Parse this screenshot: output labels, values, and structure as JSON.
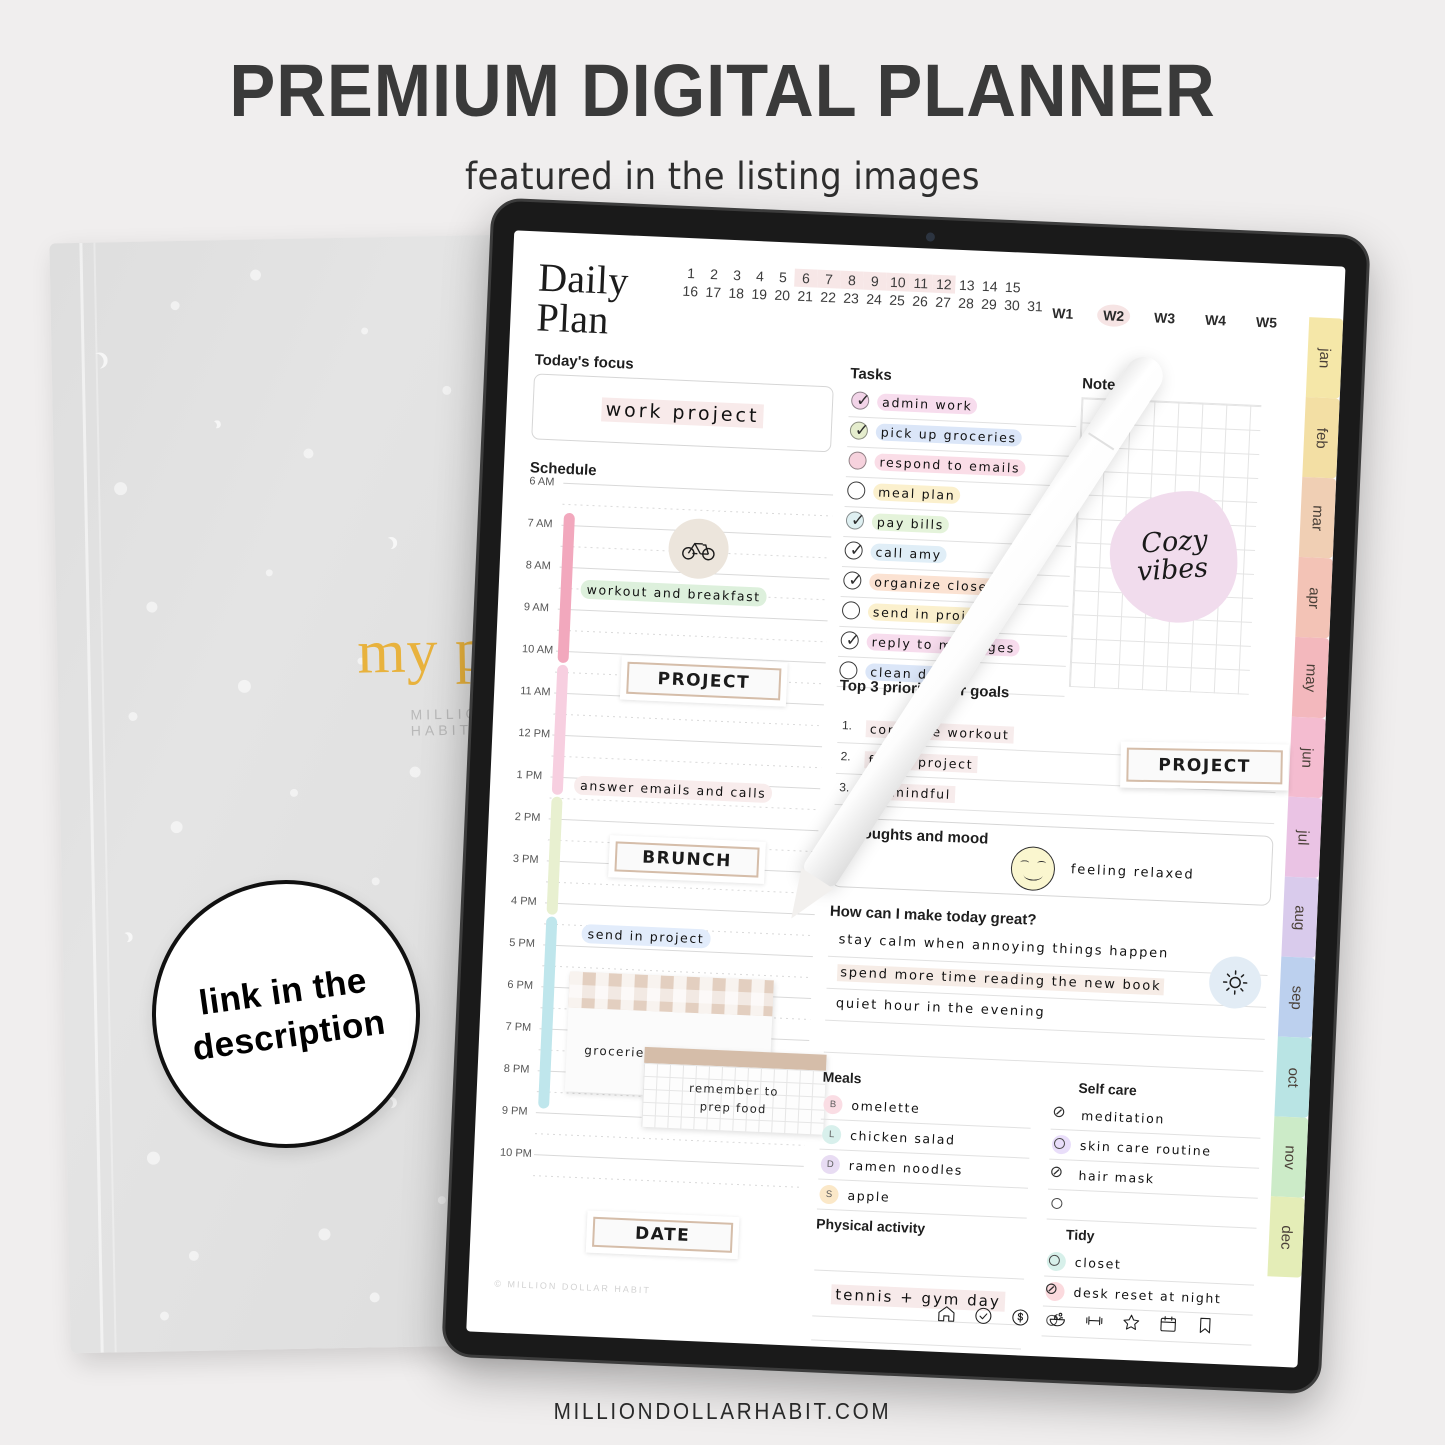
{
  "promo": {
    "title": "PREMIUM DIGITAL PLANNER",
    "subtitle": "featured in the listing images",
    "website": "MILLIONDOLLARHABIT.COM"
  },
  "badge": {
    "line1": "link in the",
    "line2": "description"
  },
  "notebook": {
    "title": "my plan",
    "brand": "MILLION DOLLAR HABIT"
  },
  "planner": {
    "page_title": "Daily Plan",
    "dates_row1": [
      "1",
      "2",
      "3",
      "4",
      "5",
      "6",
      "7",
      "8",
      "9",
      "10",
      "11",
      "12",
      "13",
      "14",
      "15"
    ],
    "dates_row2": [
      "16",
      "17",
      "18",
      "19",
      "20",
      "21",
      "22",
      "23",
      "24",
      "25",
      "26",
      "27",
      "28",
      "29",
      "30",
      "31"
    ],
    "highlighted_dates": [
      "6",
      "7",
      "8",
      "9",
      "10",
      "11",
      "12"
    ],
    "weeks": [
      "W1",
      "W2",
      "W3",
      "W4",
      "W5"
    ],
    "selected_week": "W2",
    "months": [
      {
        "label": "jan",
        "color": "#f5e7a8"
      },
      {
        "label": "feb",
        "color": "#f3dfa4"
      },
      {
        "label": "mar",
        "color": "#f0cfb4"
      },
      {
        "label": "apr",
        "color": "#f3c3b6"
      },
      {
        "label": "may",
        "color": "#f3b8bd"
      },
      {
        "label": "jun",
        "color": "#f4bcd0"
      },
      {
        "label": "jul",
        "color": "#eac3e4"
      },
      {
        "label": "aug",
        "color": "#d9cbec"
      },
      {
        "label": "sep",
        "color": "#bcd0ee"
      },
      {
        "label": "oct",
        "color": "#b9e4e4"
      },
      {
        "label": "nov",
        "color": "#ccebc8"
      },
      {
        "label": "dec",
        "color": "#e4edb7"
      }
    ],
    "focus": {
      "label": "Today's focus",
      "value": "work project"
    },
    "schedule": {
      "label": "Schedule",
      "times": [
        "6 AM",
        "7 AM",
        "8 AM",
        "9 AM",
        "10 AM",
        "11 AM",
        "12 PM",
        "1 PM",
        "2 PM",
        "3 PM",
        "4 PM",
        "5 PM",
        "6 PM",
        "7 PM",
        "8 PM",
        "9 PM",
        "10 PM"
      ],
      "icon": "bicycle-icon",
      "entries": [
        {
          "text": "workout and breakfast",
          "color": "#ddf0dc"
        },
        {
          "text": "PROJECT",
          "type": "box"
        },
        {
          "text": "answer emails and calls",
          "color": "#f8ecec"
        },
        {
          "text": "BRUNCH",
          "type": "box"
        },
        {
          "text": "send in project",
          "color": "#e2ecfb"
        },
        {
          "text": "DATE",
          "type": "box"
        }
      ],
      "timebars": [
        {
          "color": "#f2a8bd"
        },
        {
          "color": "#f7cfe0"
        },
        {
          "color": "#e8f0d0"
        },
        {
          "color": "#bfe6ec"
        }
      ],
      "sticky_note_1": "groceries and planning",
      "sticky_note_2_line1": "remember to",
      "sticky_note_2_line2": "prep food"
    },
    "tasks": {
      "label": "Tasks",
      "items": [
        {
          "text": "admin work",
          "color": "#f7dced",
          "check": "checked",
          "bullet": "#f2d4e8"
        },
        {
          "text": "pick up groceries",
          "color": "#dbe6f8",
          "check": "checked",
          "bullet": "#e5edcd"
        },
        {
          "text": "respond to emails",
          "color": "#fadde7",
          "check": "empty",
          "bullet": "#f6d2dd"
        },
        {
          "text": "meal plan",
          "color": "#fbf0cd",
          "check": "empty",
          "bullet": "#ffffff"
        },
        {
          "text": "pay bills",
          "color": "#e4f3da",
          "check": "checked",
          "bullet": "#dff0f2"
        },
        {
          "text": "call amy",
          "color": "#e0eef7",
          "check": "checked",
          "bullet": "#ffffff"
        },
        {
          "text": "organize closet",
          "color": "#fbe2d2",
          "check": "checked",
          "bullet": "#ffffff"
        },
        {
          "text": "send in project",
          "color": "#fbf0cd",
          "check": "empty",
          "bullet": "#ffffff"
        },
        {
          "text": "reply to messages",
          "color": "#f7dced",
          "check": "checked",
          "bullet": "#ffffff"
        },
        {
          "text": "clean desk",
          "color": "#dbe6f8",
          "check": "empty",
          "bullet": "#ffffff"
        }
      ]
    },
    "notes": {
      "label": "Notes",
      "sticker_line1": "Cozy",
      "sticker_line2": "vibes",
      "sticker_color": "#f1dced"
    },
    "priorities": {
      "label": "Top 3 priorities or goals",
      "items": [
        {
          "num": "1.",
          "text": "complete workout"
        },
        {
          "num": "2.",
          "text": "finish project"
        },
        {
          "num": "3.",
          "text": "be mindful"
        }
      ],
      "stamp": "PROJECT"
    },
    "mood": {
      "label": "Thoughts and mood",
      "icon": "smiley-face-icon",
      "text": "feeling relaxed"
    },
    "great": {
      "label": "How can I make today great?",
      "items": [
        {
          "text": "stay calm when annoying things happen",
          "highlight": false
        },
        {
          "text": "spend more time reading the new book",
          "highlight": true
        },
        {
          "text": "quiet hour in the evening",
          "highlight": false
        }
      ],
      "icon": "sun-icon"
    },
    "meals": {
      "label": "Meals",
      "items": [
        {
          "key": "B",
          "text": "omelette",
          "color": "#fadde4"
        },
        {
          "key": "L",
          "text": "chicken salad",
          "color": "#d8f0ec"
        },
        {
          "key": "D",
          "text": "ramen noodles",
          "color": "#e8dcf3"
        },
        {
          "key": "S",
          "text": "apple",
          "color": "#fbe8c8"
        }
      ]
    },
    "activity": {
      "label": "Physical activity",
      "value": "tennis + gym day"
    },
    "selfcare": {
      "label": "Self care",
      "items": [
        {
          "text": "meditation",
          "state": "done",
          "color": "transparent"
        },
        {
          "text": "skin care routine",
          "state": "open",
          "color": "#e9defa"
        },
        {
          "text": "hair mask",
          "state": "done",
          "color": "transparent"
        },
        {
          "text": "",
          "state": "open",
          "color": "transparent"
        }
      ]
    },
    "tidy": {
      "label": "Tidy",
      "items": [
        {
          "text": "closet",
          "state": "open",
          "color": "#d7f0ea"
        },
        {
          "text": "desk reset at night",
          "state": "done",
          "color": "#fbdade"
        },
        {
          "text": "",
          "state": "open",
          "color": "transparent"
        }
      ]
    },
    "copyright": "© MILLION DOLLAR HABIT",
    "navbar": [
      {
        "icon": "home-icon",
        "glyph": "⌂"
      },
      {
        "icon": "check-circle-icon",
        "glyph": "✓"
      },
      {
        "icon": "money-circle-icon",
        "glyph": "$"
      },
      {
        "icon": "salad-bowl-icon",
        "glyph": "🥗"
      },
      {
        "icon": "dumbbell-icon",
        "glyph": "⊢⊣"
      },
      {
        "icon": "star-icon",
        "glyph": "☆"
      },
      {
        "icon": "calendar-icon",
        "glyph": "▤"
      },
      {
        "icon": "bookmark-icon",
        "glyph": "🔖"
      }
    ]
  }
}
